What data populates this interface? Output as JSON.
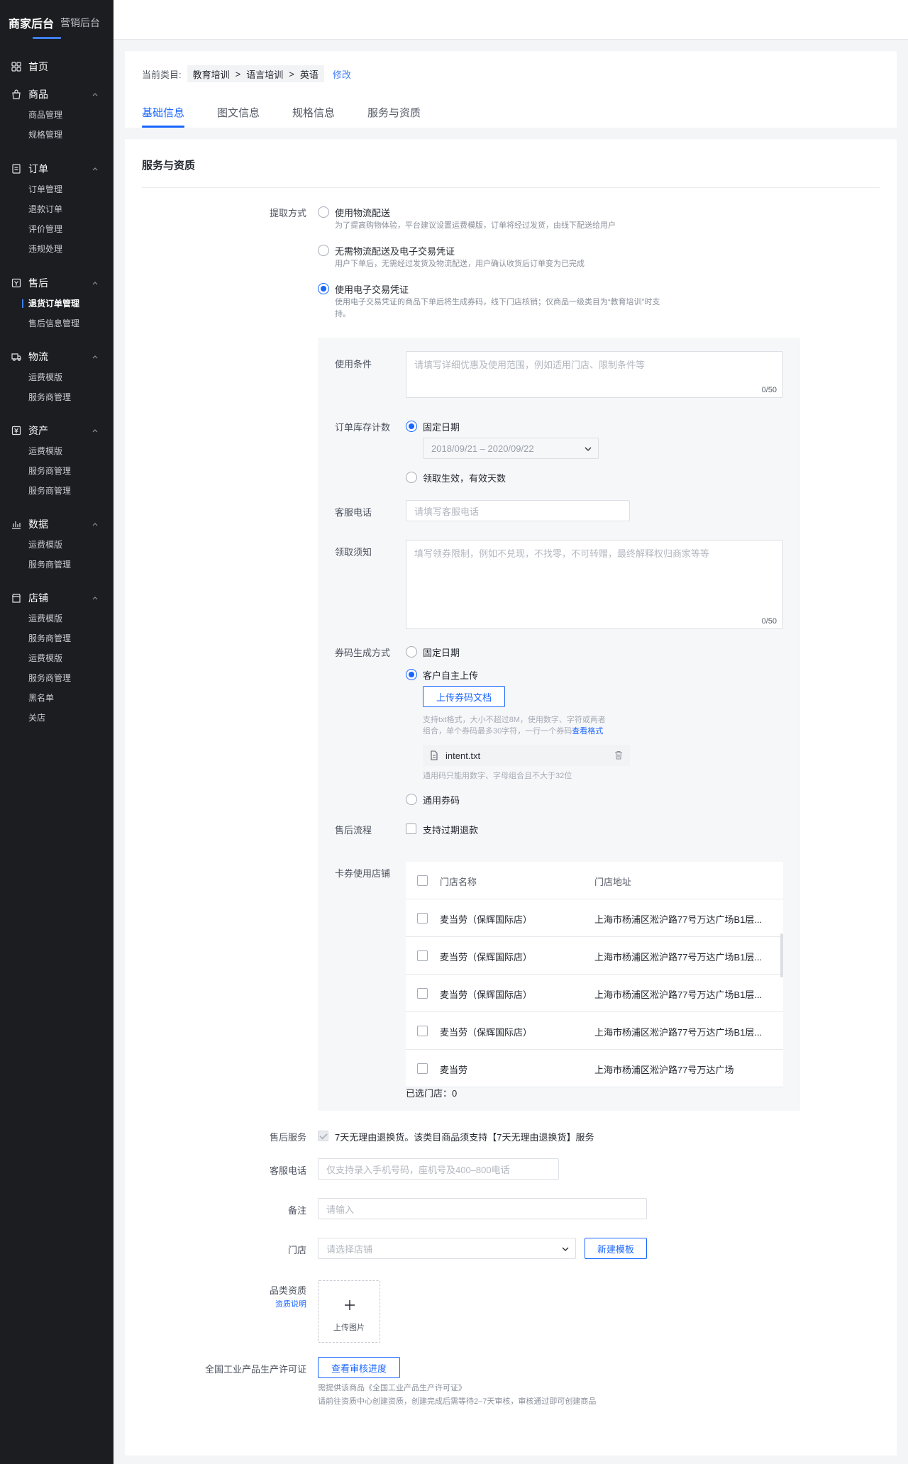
{
  "sidebar": {
    "brand": {
      "active": "商家后台",
      "other": "营销后台"
    },
    "home": "首页",
    "groups": [
      {
        "title": "商品",
        "icon": "shopping-bag-icon",
        "items": [
          "商品管理",
          "规格管理"
        ]
      },
      {
        "title": "订单",
        "icon": "order-icon",
        "items": [
          "订单管理",
          "退款订单",
          "评价管理",
          "违规处理"
        ]
      },
      {
        "title": "售后",
        "icon": "after-sale-icon",
        "items": [
          "退货订单管理",
          "售后信息管理"
        ],
        "active_item": "退货订单管理"
      },
      {
        "title": "物流",
        "icon": "truck-icon",
        "items": [
          "运费模版",
          "服务商管理"
        ]
      },
      {
        "title": "资产",
        "icon": "asset-icon",
        "items": [
          "运费模版",
          "服务商管理",
          "服务商管理"
        ]
      },
      {
        "title": "数据",
        "icon": "chart-icon",
        "items": [
          "运费模版",
          "服务商管理"
        ]
      },
      {
        "title": "店铺",
        "icon": "store-icon",
        "items": [
          "运费模版",
          "服务商管理",
          "运费模版",
          "服务商管理",
          "黑名单",
          "关店"
        ]
      }
    ]
  },
  "header": {
    "category_label": "当前类目:",
    "category_path": [
      "教育培训",
      "语言培训",
      "英语"
    ],
    "separator": ">",
    "edit_link": "修改",
    "tabs": [
      "基础信息",
      "图文信息",
      "规格信息",
      "服务与资质"
    ],
    "active_tab": "基础信息"
  },
  "main": {
    "section_title": "服务与资质",
    "pickup": {
      "label": "提取方式",
      "options": [
        {
          "title": "使用物流配送",
          "desc": "为了提高购物体验，平台建议设置运费模版，订单将经过发货，由线下配送给用户",
          "selected": false
        },
        {
          "title": "无需物流配送及电子交易凭证",
          "desc": "用户下单后，无需经过发货及物流配送，用户确认收货后订单变为已完成",
          "selected": false
        },
        {
          "title": "使用电子交易凭证",
          "desc_line1": "使用电子交易凭证的商品下单后将生成券码，线下门店核销；仅商品一级类目为“教育培训”时支",
          "desc_line2": "持。",
          "selected": true
        }
      ]
    },
    "voucher": {
      "usage_label": "使用条件",
      "usage_placeholder": "请填写详细优惠及使用范围，例如适用门店、限制条件等",
      "usage_count": "0/50",
      "stock_label": "订单库存计数",
      "stock_fixed": "固定日期",
      "stock_fixed_selected": true,
      "date_range": "2018/09/21 – 2020/09/22",
      "stock_days": "领取生效，有效天数",
      "service_phone_label": "客服电话",
      "service_phone_placeholder": "请填写客服电话",
      "notice_label": "领取须知",
      "notice_placeholder": "填写领券限制，例如不兑现，不找零，不可转赠，最终解释权归商家等等",
      "notice_count": "0/50",
      "code_label": "券码生成方式",
      "code_opt_fixed": "固定日期",
      "code_opt_upload": "客户自主上传",
      "code_opt_upload_selected": true,
      "upload_button": "上传券码文档",
      "upload_hint_line1": "支持txt格式，大小不超过8M，使用数字、字符或两者",
      "upload_hint_line2": "组合，单个券码最多30字符，一行一个券码",
      "view_format_link": "查看格式",
      "file_name": "intent.txt",
      "file_hint": "通用码只能用数字、字母组合且不大于32位",
      "code_opt_general": "通用券码",
      "aftersale_label": "售后流程",
      "aftersale_option": "支持过期退款",
      "stores_label": "卡券使用店铺",
      "store_table": {
        "headers": [
          "门店名称",
          "门店地址"
        ],
        "rows": [
          {
            "name": "麦当劳（保辉国际店）",
            "address": "上海市杨浦区淞沪路77号万达广场B1层..."
          },
          {
            "name": "麦当劳（保辉国际店）",
            "address": "上海市杨浦区淞沪路77号万达广场B1层..."
          },
          {
            "name": "麦当劳（保辉国际店）",
            "address": "上海市杨浦区淞沪路77号万达广场B1层..."
          },
          {
            "name": "麦当劳（保辉国际店）",
            "address": "上海市杨浦区淞沪路77号万达广场B1层..."
          },
          {
            "name": "麦当劳",
            "address": "上海市杨浦区淞沪路77号万达广场"
          }
        ]
      },
      "selected_stores": "已选门店：0"
    },
    "after_service": {
      "label": "售后服务",
      "text": "7天无理由退换货。该类目商品须支持【7天无理由退换货】服务"
    },
    "phone": {
      "label": "客服电话",
      "placeholder": "仅支持录入手机号码，座机号及400–800电话"
    },
    "remark": {
      "label": "备注",
      "placeholder": "请输入"
    },
    "store": {
      "label": "门店",
      "placeholder": "请选择店铺",
      "new_button": "新建模板"
    },
    "qualification": {
      "label": "品类资质",
      "link": "资质说明",
      "upload_text": "上传图片"
    },
    "license": {
      "label": "全国工业产品生产许可证",
      "button": "查看审核进度",
      "hint_line1": "需提供该商品《全国工业产品生产许可证》",
      "hint_line2": "请前往资质中心创建资质，创建完成后需等待2–7天审核，审核通过即可创建商品"
    }
  },
  "colors": {
    "primary": "#1966ff",
    "sidebar_bg": "#1b1d21",
    "panel_bg": "#f6f7f9"
  }
}
